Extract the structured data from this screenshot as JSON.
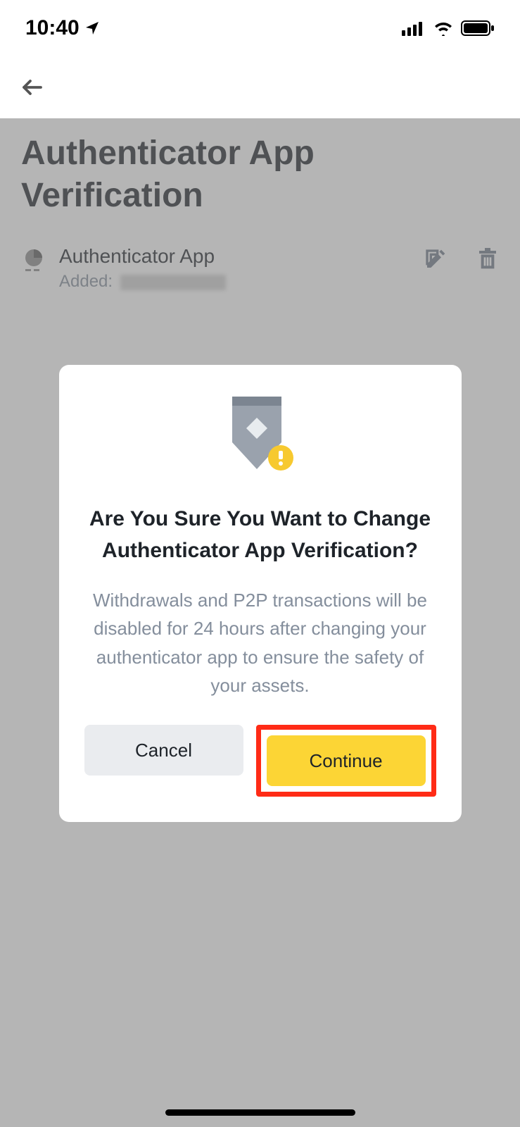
{
  "status": {
    "time": "10:40"
  },
  "page": {
    "title": "Authenticator App Verification"
  },
  "auth": {
    "name": "Authenticator App",
    "added_label": "Added:"
  },
  "dialog": {
    "title": "Are You Sure You Want to Change Authenticator App Verification?",
    "body": "Withdrawals and P2P transactions will be disabled for 24 hours after changing your authenticator app to ensure the safety of your assets.",
    "cancel": "Cancel",
    "continue": "Continue"
  }
}
